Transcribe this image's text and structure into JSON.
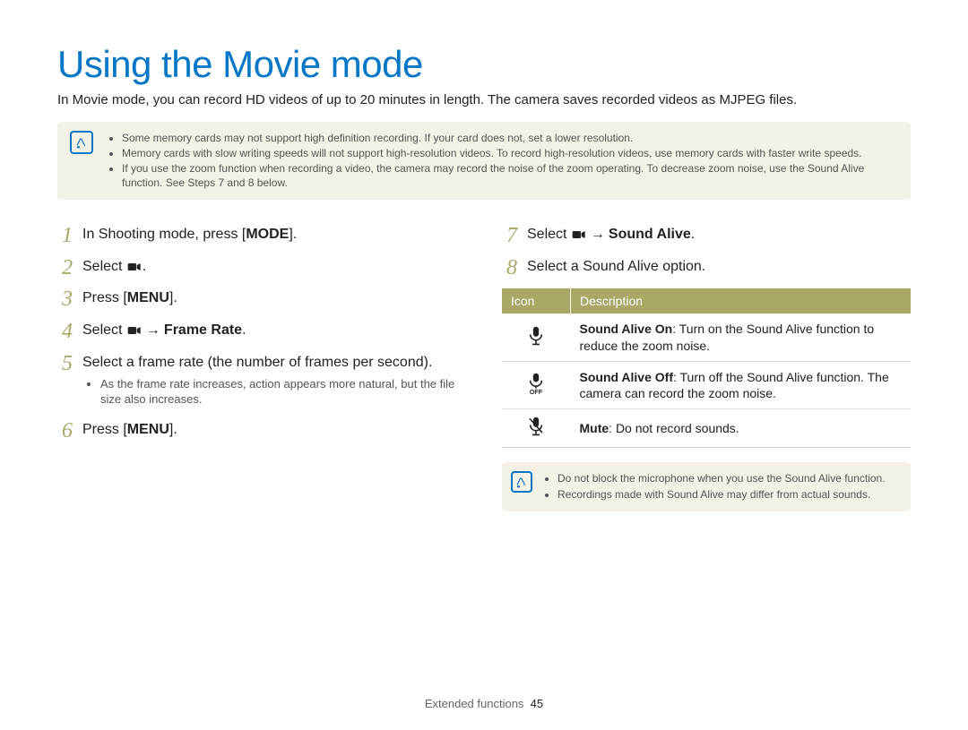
{
  "title": "Using the Movie mode",
  "intro": "In Movie mode, you can record HD videos of up to 20 minutes in length. The camera saves recorded videos as MJPEG files.",
  "top_notes": [
    "Some memory cards may not support high definition recording. If your card does not, set a lower resolution.",
    "Memory cards with slow writing speeds will not support high-resolution videos. To record high-resolution videos, use memory cards with faster write speeds.",
    "If you use the zoom function when recording a video, the camera may record the noise of the zoom operating. To decrease zoom noise, use the Sound Alive function. See Steps 7 and 8 below."
  ],
  "steps_left": {
    "s1": {
      "num": "1",
      "pre": "In Shooting mode, press [",
      "btn": "MODE",
      "post": "]."
    },
    "s2": {
      "num": "2",
      "pre": "Select ",
      "post": "."
    },
    "s3": {
      "num": "3",
      "pre": "Press [",
      "btn": "MENU",
      "post": "]."
    },
    "s4": {
      "num": "4",
      "pre": "Select ",
      "arrow": "→",
      "bold": "Frame Rate",
      "post": "."
    },
    "s5": {
      "num": "5",
      "text": "Select a frame rate (the number of frames per second).",
      "sub": "As the frame rate increases, action appears more natural, but the file size also increases."
    },
    "s6": {
      "num": "6",
      "pre": "Press [",
      "btn": "MENU",
      "post": "]."
    }
  },
  "steps_right": {
    "s7": {
      "num": "7",
      "pre": "Select ",
      "arrow": "→",
      "bold": "Sound Alive",
      "post": "."
    },
    "s8": {
      "num": "8",
      "text": "Select a Sound Alive option."
    }
  },
  "table": {
    "head_icon": "Icon",
    "head_desc": "Description",
    "rows": [
      {
        "bold": "Sound Alive On",
        "rest": ": Turn on the Sound Alive function to reduce the zoom noise."
      },
      {
        "bold": "Sound Alive Off",
        "rest": ": Turn off the Sound Alive function. The camera can record the zoom noise."
      },
      {
        "bold": "Mute",
        "rest": ": Do not record sounds."
      }
    ]
  },
  "bottom_notes": [
    "Do not block the microphone when you use the Sound Alive function.",
    "Recordings made with Sound Alive may differ from actual sounds."
  ],
  "footer_section": "Extended functions",
  "footer_page": "45"
}
